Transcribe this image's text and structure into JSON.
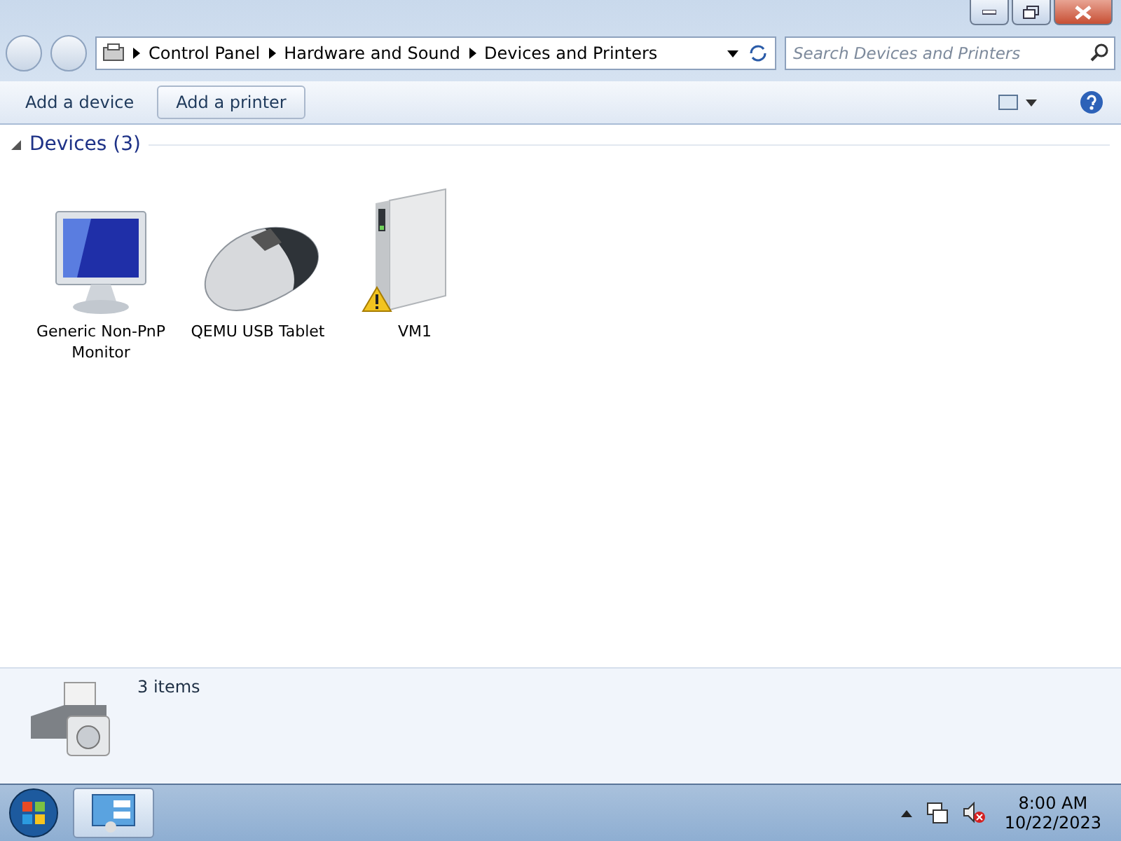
{
  "breadcrumb": [
    "Control Panel",
    "Hardware and Sound",
    "Devices and Printers"
  ],
  "search": {
    "placeholder": "Search Devices and Printers"
  },
  "toolbar": {
    "buttons": [
      {
        "label": "Add a device",
        "hovered": false
      },
      {
        "label": "Add a printer",
        "hovered": true
      }
    ]
  },
  "group": {
    "title": "Devices (3)",
    "expanded": true
  },
  "devices": [
    {
      "kind": "monitor",
      "name": "Generic Non-PnP Monitor",
      "warning": false
    },
    {
      "kind": "mouse",
      "name": "QEMU USB Tablet",
      "warning": false
    },
    {
      "kind": "computer",
      "name": "VM1",
      "warning": true
    }
  ],
  "details": {
    "count": "3 items"
  },
  "taskbar": {
    "time": "8:00 AM",
    "date": "10/22/2023"
  }
}
